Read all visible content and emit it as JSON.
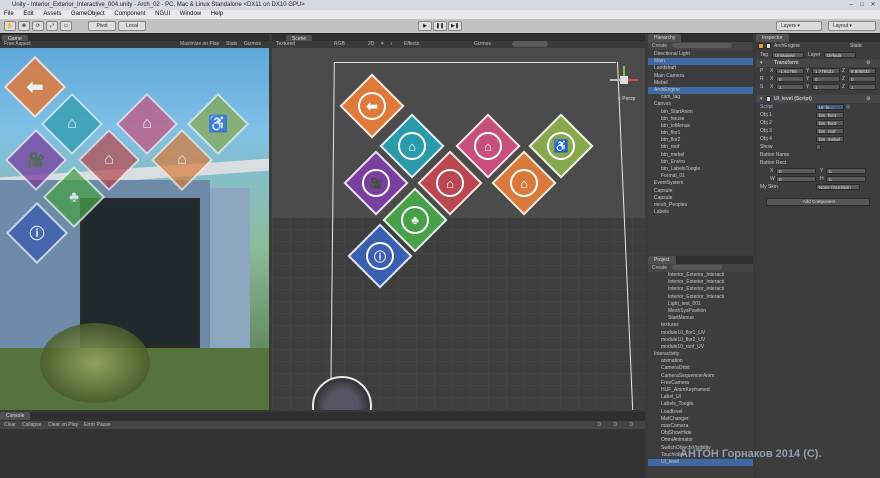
{
  "window": {
    "title": "Unity - Interior_Exterior_Interactive_004.unity - Arch_02 - PC, Mac & Linux Standalone <DX11 on DX10 GPU>",
    "menu": [
      "File",
      "Edit",
      "Assets",
      "GameObject",
      "Component",
      "NGUI",
      "Window",
      "Help"
    ]
  },
  "toolbar": {
    "pivot": "Pivot",
    "local": "Local",
    "play": "▶",
    "pause": "❚❚",
    "step": "▶❚",
    "layers": "Layers",
    "layout": "Layout"
  },
  "game": {
    "tab": "Game",
    "aspect": "Free Aspect",
    "maximize": "Maximize on Play",
    "stats": "Stats",
    "gizmos": "Gizmos"
  },
  "scene": {
    "tab": "Scene",
    "shading": "Textured",
    "rgb": "RGB",
    "mode2d": "2D",
    "effects": "Effects",
    "gizmos": "Gizmos",
    "persp": "< Persp"
  },
  "hierarchy": {
    "tab": "Hierarchy",
    "create": "Create",
    "search_placeholder": "All",
    "items": [
      {
        "label": "Directional Light",
        "indent": 0
      },
      {
        "label": "Main",
        "indent": 0,
        "selected": true
      },
      {
        "label": "Landshaft",
        "indent": 0
      },
      {
        "label": "Main Camera",
        "indent": 0
      },
      {
        "label": "Mebel",
        "indent": 0
      },
      {
        "label": "ArchEngine",
        "indent": 0,
        "selected": true
      },
      {
        "label": "cam_tag",
        "indent": 1
      },
      {
        "label": "Canvas",
        "indent": 0
      },
      {
        "label": "btn_StartAnim",
        "indent": 1
      },
      {
        "label": "btn_house",
        "indent": 1
      },
      {
        "label": "btn_toMenue",
        "indent": 1
      },
      {
        "label": "btn_flor1",
        "indent": 1
      },
      {
        "label": "btn_flor2",
        "indent": 1
      },
      {
        "label": "btn_roof",
        "indent": 1
      },
      {
        "label": "btn_mebel",
        "indent": 1
      },
      {
        "label": "btn_Enviro",
        "indent": 1
      },
      {
        "label": "btn_LabelsToogle",
        "indent": 1
      },
      {
        "label": "Formal_01",
        "indent": 1
      },
      {
        "label": "EventSystem",
        "indent": 0
      },
      {
        "label": "Capsule",
        "indent": 0
      },
      {
        "label": "Capsule",
        "indent": 0
      },
      {
        "label": "mesh_Peoples",
        "indent": 0
      },
      {
        "label": "Labels",
        "indent": 0
      }
    ]
  },
  "project": {
    "tab": "Project",
    "create": "Create",
    "items": [
      {
        "label": "Interior_Exterior_Interacti",
        "indent": 2
      },
      {
        "label": "Interior_Exterior_Interacti",
        "indent": 2
      },
      {
        "label": "Interior_Exterior_Interacti",
        "indent": 2
      },
      {
        "label": "Interior_Exterior_Interacti",
        "indent": 2
      },
      {
        "label": "Light_test_001",
        "indent": 2
      },
      {
        "label": "MeshSysPavilion",
        "indent": 2
      },
      {
        "label": "StartMenue",
        "indent": 2
      },
      {
        "label": "textures",
        "indent": 1
      },
      {
        "label": "module10_flor1_UV",
        "indent": 1
      },
      {
        "label": "module10_flor2_UV",
        "indent": 1
      },
      {
        "label": "module10_roof_UV",
        "indent": 1
      },
      {
        "label": "Interactivity",
        "indent": 0
      },
      {
        "label": "animation",
        "indent": 1
      },
      {
        "label": "CameraOrbit",
        "indent": 1
      },
      {
        "label": "CameraSequencerAnim",
        "indent": 1
      },
      {
        "label": "FreeCamera",
        "indent": 1
      },
      {
        "label": "HUF_AnimKeyframed",
        "indent": 1
      },
      {
        "label": "Label_UI",
        "indent": 1
      },
      {
        "label": "Labels_Toogle",
        "indent": 1
      },
      {
        "label": "Loadlevel",
        "indent": 1
      },
      {
        "label": "MatChanger",
        "indent": 1
      },
      {
        "label": "maxCamera",
        "indent": 1
      },
      {
        "label": "ObjShowHide",
        "indent": 1
      },
      {
        "label": "OmniAnimator",
        "indent": 1
      },
      {
        "label": "SwitchObjectsVisibility",
        "indent": 1
      },
      {
        "label": "Touchloller",
        "indent": 1
      },
      {
        "label": "UI_level",
        "indent": 1,
        "selected": true
      }
    ]
  },
  "inspector": {
    "tab": "Inspector",
    "object_name": "ArchEngine",
    "static": "Static",
    "tag_label": "Tag",
    "tag_value": "Untagged",
    "layer_label": "Layer",
    "layer_value": "Default",
    "transform": "Transform",
    "pos_x": "-1.61786",
    "pos_y": "1.778522",
    "pos_z": "8.808832",
    "rot_x": "0",
    "rot_y": "0",
    "rot_z": "0",
    "scl_x": "1",
    "scl_y": "1",
    "scl_z": "1",
    "P": "P",
    "R": "R",
    "S": "S",
    "x": "X",
    "y": "Y",
    "z": "Z",
    "script_component": "UI_level (Script)",
    "script_label": "Script",
    "script_value": "UI_le...",
    "obj1_label": "Obj 1",
    "obj1_value": "btn_flor1",
    "obj2_label": "Obj 2",
    "obj2_value": "btn_flor2",
    "obj3_label": "Obj 3",
    "obj3_value": "btn_roof",
    "obj4_label": "Obj 4",
    "obj4_value": "btn_mebel",
    "show_label": "Show",
    "button_name_label": "Button Name",
    "button_rect_label": "Button Rect",
    "rect_x": "0",
    "rect_y": "0",
    "rect_w": "0",
    "rect_h": "0",
    "W": "W",
    "H": "H",
    "my_skin_label": "My Skin",
    "my_skin_value": "None (GUISkin)",
    "add_component": "Add Component"
  },
  "console": {
    "tab": "Console",
    "clear": "Clear",
    "collapse": "Collapse",
    "clear_on_play": "Clear on Play",
    "error_pause": "Error Pause",
    "count_a": "0",
    "count_b": "0",
    "count_c": "0"
  },
  "watermark": "АНТОН Горнаков 2014 (C).",
  "colors": {
    "btn_back": "#e07a3a",
    "btn_house": "#2a9bab",
    "btn_flor": "#c84f7a",
    "btn_roof": "#d87b3a",
    "btn_mebel": "#87a84d",
    "btn_cam": "#7a3fa0",
    "btn_enviro": "#48a04a",
    "btn_info": "#3a5fb0",
    "btn_flor1": "#b8474f"
  }
}
